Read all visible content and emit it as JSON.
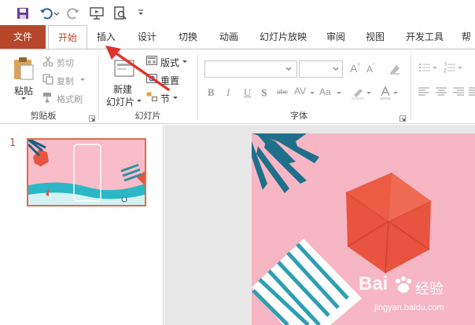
{
  "tabs": [
    "文件",
    "开始",
    "插入",
    "设计",
    "切换",
    "动画",
    "幻灯片放映",
    "审阅",
    "视图",
    "开发工具",
    "帮"
  ],
  "clipboard": {
    "paste": "粘贴",
    "cut": "剪切",
    "copy": "复制",
    "format_painter": "格式刷",
    "group": "剪贴板"
  },
  "slides": {
    "new_slide_line1": "新建",
    "new_slide_line2": "幻灯片",
    "layout": "版式",
    "reset": "重置",
    "section": "节",
    "group": "幻灯片"
  },
  "font": {
    "group": "字体",
    "bold": "B",
    "italic": "I",
    "underline": "U",
    "shadow": "S",
    "strike": "abc",
    "spacing": "AV",
    "case": "Aa"
  },
  "thumbnail": {
    "number": "1"
  },
  "watermark": {
    "brand": "Bai",
    "brand2": "经验",
    "url": "jingyan.baidu.com"
  }
}
